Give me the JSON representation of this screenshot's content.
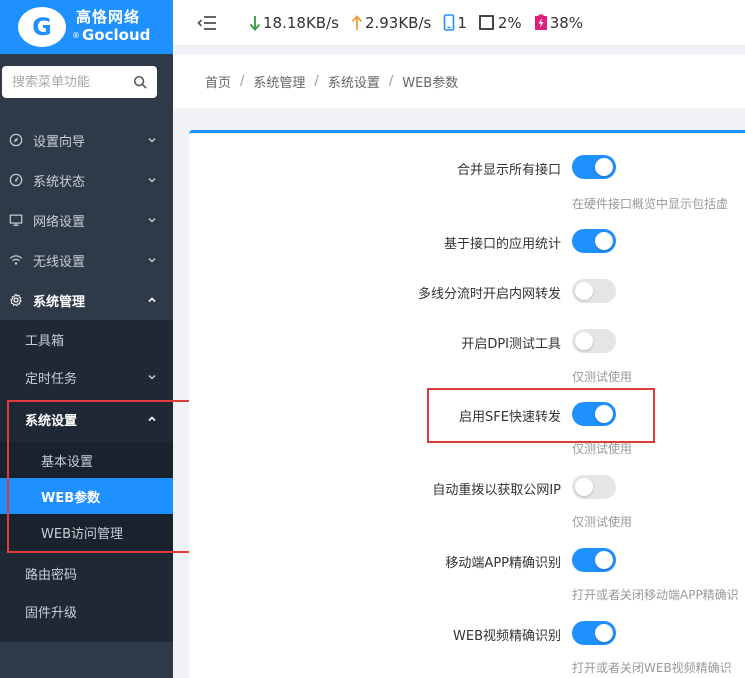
{
  "logo": {
    "cn": "高恪网络",
    "en": "Gocloud",
    "reg": "®",
    "mark": "G"
  },
  "search": {
    "placeholder": "搜索菜单功能"
  },
  "sidebar": {
    "items": [
      {
        "label": "设置向导",
        "icon": "compass-icon"
      },
      {
        "label": "系统状态",
        "icon": "dashboard-icon"
      },
      {
        "label": "网络设置",
        "icon": "monitor-icon"
      },
      {
        "label": "无线设置",
        "icon": "wifi-icon"
      },
      {
        "label": "系统管理",
        "icon": "gear-icon"
      }
    ],
    "sub": {
      "toolbox": "工具箱",
      "schedule": "定时任务",
      "settings": "系统设置",
      "basic": "基本设置",
      "web_params": "WEB参数",
      "web_access": "WEB访问管理",
      "router_pwd": "路由密码",
      "firmware": "固件升级"
    }
  },
  "topbar": {
    "download": "18.18KB/s",
    "upload": "2.93KB/s",
    "devices": "1",
    "cpu": "2%",
    "memory": "38%",
    "colors": {
      "down": "#2e9e3e",
      "up": "#f0a030",
      "device": "#1e90ff",
      "mem": "#e0207a"
    }
  },
  "breadcrumb": [
    "首页",
    "系统管理",
    "系统设置",
    "WEB参数"
  ],
  "settings": [
    {
      "label": "合并显示所有接口",
      "on": true,
      "hint": "在硬件接口概览中显示包括虚"
    },
    {
      "label": "基于接口的应用统计",
      "on": true,
      "hint": ""
    },
    {
      "label": "多线分流时开启内网转发",
      "on": false,
      "hint": ""
    },
    {
      "label": "开启DPI测试工具",
      "on": false,
      "hint": "仅测试使用"
    },
    {
      "label": "启用SFE快速转发",
      "on": true,
      "hint": "仅测试使用"
    },
    {
      "label": "自动重拨以获取公网IP",
      "on": false,
      "hint": "仅测试使用"
    },
    {
      "label": "移动端APP精确识别",
      "on": true,
      "hint": "打开或者关闭移动端APP精确识"
    },
    {
      "label": "WEB视频精确识别",
      "on": true,
      "hint": "打开或者关闭WEB视频精确识"
    }
  ]
}
